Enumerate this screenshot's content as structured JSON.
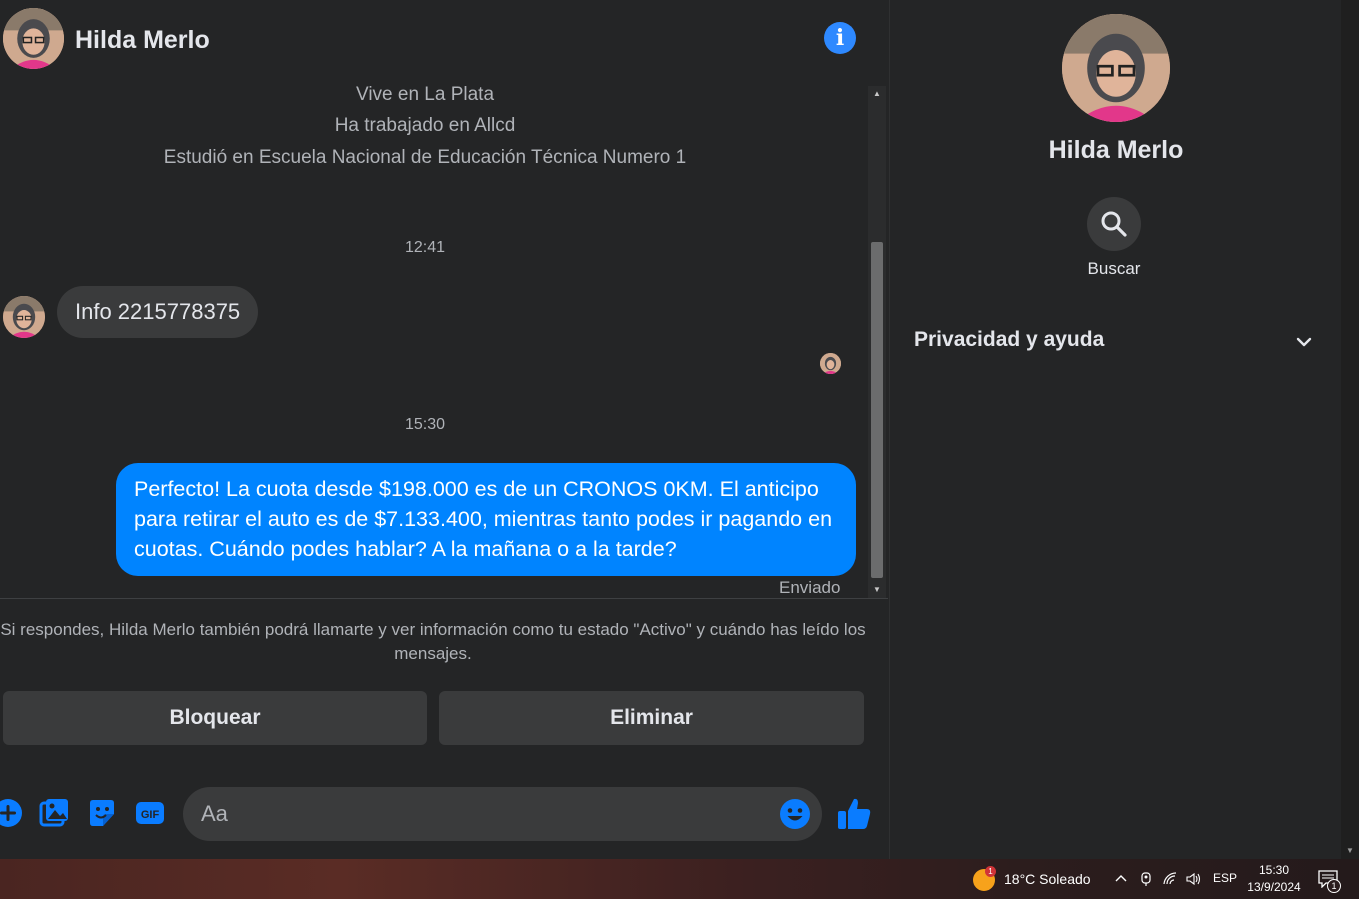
{
  "contact": {
    "name": "Hilda Merlo"
  },
  "profile_info": [
    "Vive en La Plata",
    "Ha trabajado en Allcd",
    "Estudió en Escuela Nacional de Educación Técnica Numero 1"
  ],
  "thread": {
    "timestamp_1": "12:41",
    "incoming_message": "Info 2215778375",
    "timestamp_2": "15:30",
    "outgoing_message": "Perfecto! La cuota desde $198.000 es de un CRONOS 0KM. El anticipo para retirar el auto es de $7.133.400, mientras tanto podes ir pagando en cuotas. Cuándo podes hablar? A la mañana o a la tarde?",
    "status": "Enviado"
  },
  "notice": "Si respondes, Hilda Merlo también podrá llamarte y ver información como tu estado \"Activo\" y cuándo has leído los mensajes.",
  "actions": {
    "block": "Bloquear",
    "delete": "Eliminar"
  },
  "composer": {
    "placeholder": "Aa"
  },
  "side_panel": {
    "name": "Hilda Merlo",
    "search_label": "Buscar",
    "privacy_label": "Privacidad y ayuda"
  },
  "colors": {
    "background": "#242526",
    "bubble_outgoing": "#0084ff",
    "bubble_incoming": "#3a3b3c",
    "accent": "#2e89ff"
  },
  "icons": [
    "info-icon",
    "plus-icon",
    "image-icon",
    "sticker-icon",
    "gif-icon",
    "emoji-icon",
    "like-icon",
    "search-icon",
    "chevron-down-icon",
    "weather-icon",
    "chevron-up-icon",
    "camera-icon",
    "wifi-icon",
    "volume-icon",
    "notifications-icon"
  ],
  "taskbar": {
    "weather": "18°C  Soleado",
    "weather_badge": "1",
    "language": "ESP",
    "time": "15:30",
    "date": "13/9/2024",
    "notifications_count": "1"
  }
}
